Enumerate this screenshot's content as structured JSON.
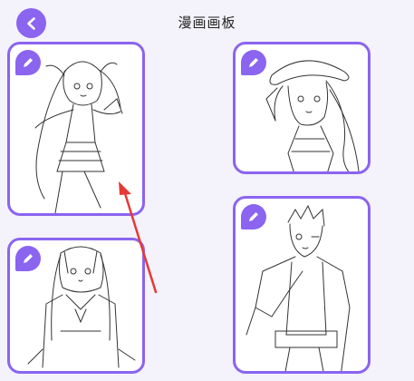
{
  "header": {
    "title": "漫画画板",
    "back_icon": "chevron-left-icon"
  },
  "accent_color": "#8b64f0",
  "annotation_color": "#e53935",
  "cards": [
    {
      "name": "anime-girl-twintails",
      "icon": "pencil-icon"
    },
    {
      "name": "anime-girl-sunhat",
      "icon": "pencil-icon"
    },
    {
      "name": "anime-girl-uniform",
      "icon": "pencil-icon"
    },
    {
      "name": "anime-boy-jacket",
      "icon": "pencil-icon"
    }
  ]
}
